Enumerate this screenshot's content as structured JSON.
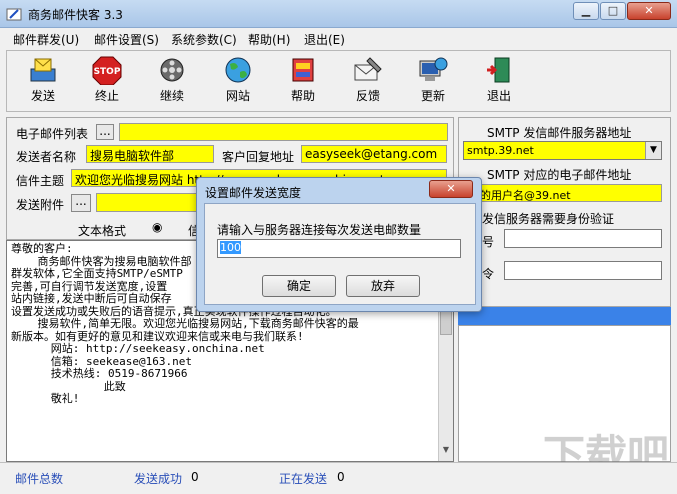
{
  "window": {
    "title": "商务邮件快客 3.3"
  },
  "menu": [
    "邮件群发(U)",
    "邮件设置(S)",
    "系统参数(C)",
    "帮助(H)",
    "退出(E)"
  ],
  "toolbar": [
    "发送",
    "终止",
    "继续",
    "网站",
    "帮助",
    "反馈",
    "更新",
    "退出"
  ],
  "left": {
    "email_list_label": "电子邮件列表",
    "sender_label": "发送者名称",
    "sender_value": "搜易电脑软件部",
    "reply_label": "客户回复地址",
    "reply_value": "easyseek@etang.com",
    "subject_label": "信件主题",
    "subject_value": "欢迎您光临搜易网站 http://www.seekeasy.onchina.net",
    "attach_label": "发送附件",
    "format_label": "文本格式",
    "format_other": "信",
    "body_lines": [
      "尊敬的客户:",
      "",
      "    商务邮件快客为搜易电脑软件部",
      "群发软体,它全面支持SMTP/eSMTP",
      "完善,可自行调节发送宽度,设置",
      "站内链接,发送中断后可自动保存",
      "设置发送成功或失败后的语音提示,真正实现软件操作过程自动化。",
      "    搜易软件,简单无限。欢迎您光临搜易网站,下载商务邮件快客的最",
      "新版本。如有更好的意见和建议欢迎来信或来电与我们联系!",
      "      网站: http://seekeasy.onchina.net",
      "      信箱: seekease@163.net",
      "      技术热线: 0519-8671966",
      "",
      "              此致",
      "",
      "      敬礼!"
    ]
  },
  "right": {
    "smtp_label": "SMTP 发信邮件服务器地址",
    "smtp_value": "smtp.39.net",
    "smtp_account_label": "SMTP 对应的电子邮件地址",
    "smtp_account_value": "的用户名@39.net",
    "auth_label": "发信服务器需要身份验证",
    "user_label": "号",
    "pass_label": "令"
  },
  "status": {
    "total_label": "邮件总数",
    "success_label": "发送成功",
    "success_value": "0",
    "sending_label": "正在发送",
    "sending_value": "0"
  },
  "dialog": {
    "title": "设置邮件发送宽度",
    "prompt": "请输入与服务器连接每次发送电邮数量",
    "input_value": "100",
    "ok_label": "确定",
    "cancel_label": "放弃"
  },
  "watermark": "下载吧"
}
